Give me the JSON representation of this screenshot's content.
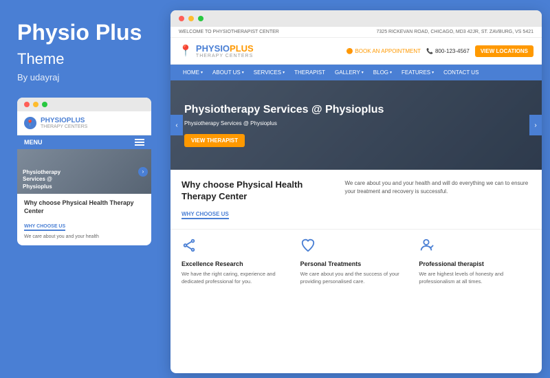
{
  "left": {
    "title": "Physio Plus",
    "subtitle": "Theme",
    "author": "By udayraj",
    "dots": [
      "red",
      "yellow",
      "green"
    ],
    "mobile": {
      "logo_name": "PHYSIOPLUS",
      "logo_sub": "THERAPY CENTERS",
      "menu_label": "MENU",
      "hero_text": "Physiotherapy\nServices @\nPhysioplus",
      "section_title": "Why choose Physical Health Therapy Center",
      "why_label": "WHY CHOOSE US",
      "section_text": "We care about you and your health"
    }
  },
  "browser": {
    "topbar_left": "WELCOME TO PHYSIOTHERAPIST CENTER",
    "topbar_right": "7325 RICKEVAN ROAD, CHICAGO, MD3 42JR, ST. ZAVBURG, VS 5421",
    "logo_name": "PHYSIOPLUS",
    "logo_sub": "THERAPY CENTERS",
    "book_appt": "BOOK AN APPOINTMENT",
    "phone": "800-123-4567",
    "view_locations": "VIEW LOCATIONS",
    "nav": [
      {
        "label": "HOME",
        "caret": true
      },
      {
        "label": "ABOUT US",
        "caret": true
      },
      {
        "label": "SERVICES",
        "caret": true
      },
      {
        "label": "THERAPIST"
      },
      {
        "label": "GALLERY",
        "caret": true
      },
      {
        "label": "BLOG",
        "caret": true
      },
      {
        "label": "FEATURES",
        "caret": true
      },
      {
        "label": "CONTACT US"
      }
    ],
    "hero": {
      "title": "Physiotherapy Services @ Physioplus",
      "subtitle": "Physiotherapy Services @ Physioplus",
      "cta": "VIEW THERAPIST"
    },
    "why": {
      "title": "Why choose Physical Health Therapy Center",
      "label": "WHY CHOOSE US",
      "text": "We care about you and your health and will do everything we can to ensure your treatment and recovery is successful."
    },
    "features": [
      {
        "icon": "share",
        "title": "Excellence Research",
        "text": "We have the right caring, experience and dedicated professional for you."
      },
      {
        "icon": "heart",
        "title": "Personal Treatments",
        "text": "We care about you and the success of your providing personalised care."
      },
      {
        "icon": "person",
        "title": "Professional therapist",
        "text": "We are highest levels of honesty and professionalism at all times."
      }
    ]
  }
}
